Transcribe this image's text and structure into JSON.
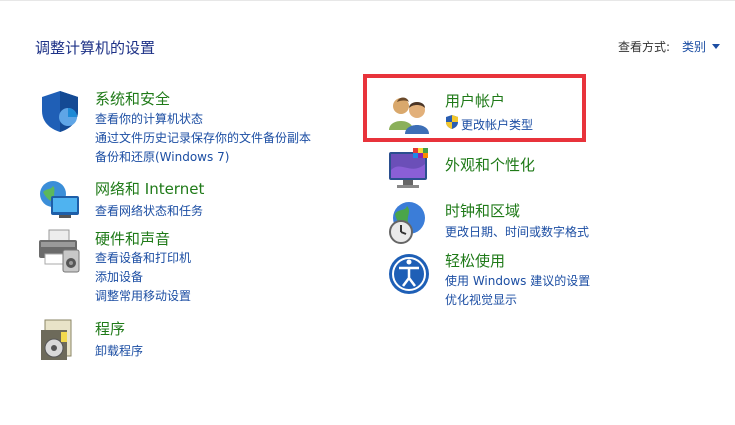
{
  "header": {
    "title": "调整计算机的设置",
    "view_by_label": "查看方式:",
    "view_by_value": "类别"
  },
  "categories": {
    "system_security": {
      "title": "系统和安全",
      "links": [
        "查看你的计算机状态",
        "通过文件历史记录保存你的文件备份副本",
        "备份和还原(Windows 7)"
      ]
    },
    "network": {
      "title": "网络和 Internet",
      "links": [
        "查看网络状态和任务"
      ]
    },
    "hardware": {
      "title": "硬件和声音",
      "links": [
        "查看设备和打印机",
        "添加设备",
        "调整常用移动设置"
      ]
    },
    "programs": {
      "title": "程序",
      "links": [
        "卸载程序"
      ]
    },
    "user_accounts": {
      "title": "用户帐户",
      "links": [
        "更改帐户类型"
      ]
    },
    "appearance": {
      "title": "外观和个性化"
    },
    "clock_region": {
      "title": "时钟和区域",
      "links": [
        "更改日期、时间或数字格式"
      ]
    },
    "ease_of_access": {
      "title": "轻松使用",
      "links": [
        "使用 Windows 建议的设置",
        "优化视觉显示"
      ]
    }
  },
  "colors": {
    "title_green": "#1f7a18",
    "link_blue": "#1c4ea3",
    "highlight_red": "#e8333b"
  }
}
